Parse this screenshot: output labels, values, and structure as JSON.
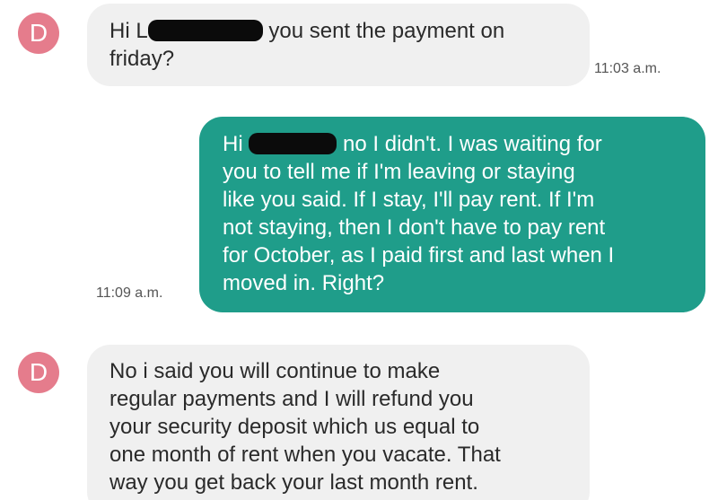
{
  "messages": [
    {
      "direction": "incoming",
      "avatar_letter": "D",
      "lines": [
        "Hi L",
        "you sent the payment on",
        "friday?"
      ],
      "time": "11:03 a.m."
    },
    {
      "direction": "outgoing",
      "lines": [
        "Hi",
        "no I didn't. I was waiting for",
        "you to tell me if I'm leaving or staying",
        "like you said. If I stay, I'll pay rent. If I'm",
        "not staying, then I don't have to pay rent",
        "for October, as I paid first and last when I",
        "moved in. Right?"
      ],
      "time": "11:09 a.m."
    },
    {
      "direction": "incoming",
      "avatar_letter": "D",
      "lines": [
        "No i said you will continue to make",
        "regular payments and I will refund you",
        "your security deposit which us equal to",
        "one month of rent when you vacate. That",
        "way you get back your last month rent."
      ]
    }
  ],
  "colors": {
    "incoming_bubble": "#f0f0f0",
    "outgoing_bubble": "#1f9d8a",
    "avatar": "#e57c8c",
    "redaction": "#0b0b0b"
  }
}
